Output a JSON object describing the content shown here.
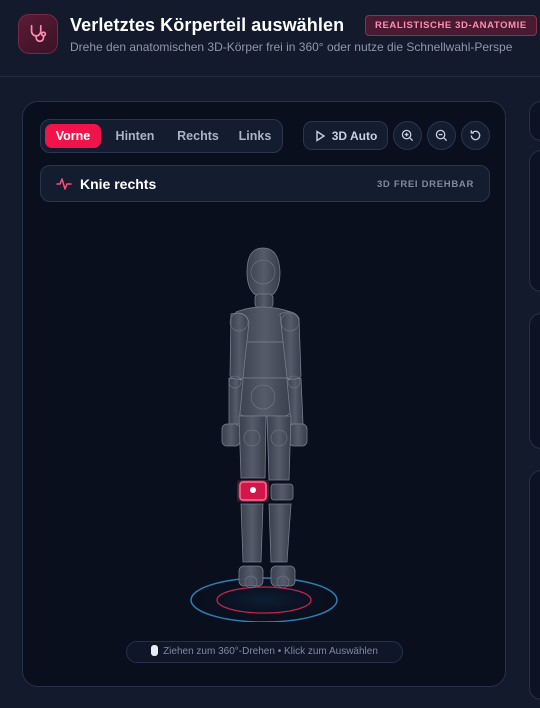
{
  "header": {
    "title": "Verletztes Körperteil auswählen",
    "badge": "REALISTISCHE 3D-ANATOMIE",
    "subtitle": "Drehe den anatomischen 3D-Körper frei in 360° oder nutze die Schnellwahl-Perspe"
  },
  "viewer": {
    "tabs": [
      {
        "label": "Vorne",
        "active": true
      },
      {
        "label": "Hinten",
        "active": false
      },
      {
        "label": "Rechts",
        "active": false
      },
      {
        "label": "Links",
        "active": false
      }
    ],
    "auto_label": "3D Auto",
    "selected_part": "Knie rechts",
    "mode_label": "3D FREI DREHBAR",
    "hint": "Ziehen zum 360°-Drehen • Klick zum Auswählen"
  },
  "colors": {
    "accent": "#f0144b",
    "highlight": "#ff3b6b",
    "background": "#0a0f1e"
  },
  "icons": {
    "app": "stethoscope-icon",
    "auto": "play-icon",
    "zoom_in": "zoom-in-icon",
    "zoom_out": "zoom-out-icon",
    "reset": "reset-icon",
    "part": "pulse-icon"
  }
}
